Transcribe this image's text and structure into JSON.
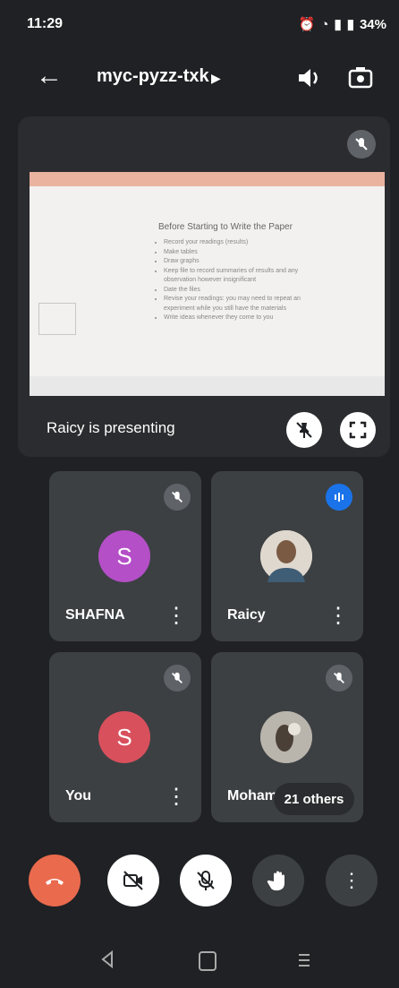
{
  "status_bar": {
    "time": "11:29",
    "battery": "34%"
  },
  "header": {
    "meeting_code": "myc-pyzz-txk"
  },
  "presentation": {
    "label": "Raicy is presenting",
    "slide_title": "Before Starting to Write the Paper",
    "slide_bullets": [
      "Record your readings (results)",
      "Make tables",
      "Draw graphs",
      "Keep file to record summaries of results and any observation however insignificant",
      "Date the files",
      "Revise your readings: you may need to repeat an experiment while you still have the materials",
      "Write ideas whenever they come to you"
    ]
  },
  "participants": [
    {
      "name": "SHAFNA",
      "initial": "S",
      "avatar_color": "#b44fc7",
      "muted": true
    },
    {
      "name": "Raicy",
      "initial": "",
      "avatar_color": "#c7b59a",
      "muted": false,
      "speaking": true
    },
    {
      "name": "You",
      "initial": "S",
      "avatar_color": "#d9505d",
      "muted": true
    },
    {
      "name": "Moham",
      "initial": "",
      "avatar_color": "#8a7c6a",
      "muted": true
    }
  ],
  "others_label": "21 others",
  "colors": {
    "background": "#202124",
    "tile": "#3c4043",
    "end_call": "#ea6a4d",
    "speaking": "#1a73e8"
  }
}
